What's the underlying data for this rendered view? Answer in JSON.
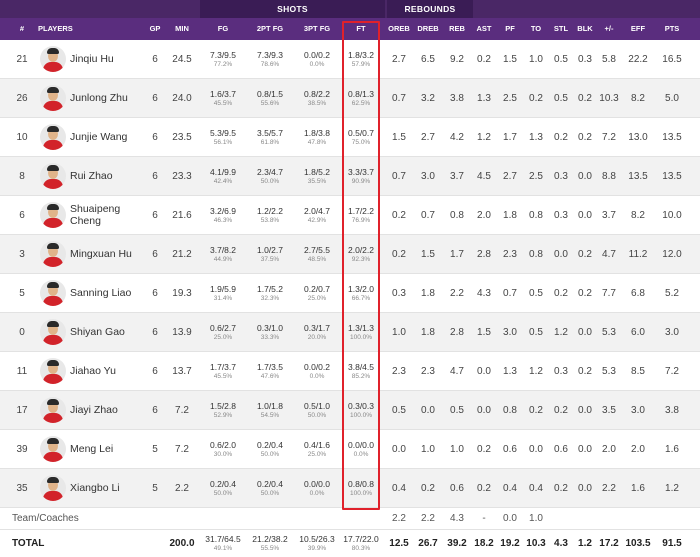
{
  "header": {
    "shots_label": "SHOTS",
    "rebounds_label": "REBOUNDS"
  },
  "columns": [
    "#",
    "PLAYERS",
    "GP",
    "MIN",
    "FG",
    "2PT FG",
    "3PT FG",
    "FT",
    "OREB",
    "DREB",
    "REB",
    "AST",
    "PF",
    "TO",
    "STL",
    "BLK",
    "+/-",
    "EFF",
    "PTS"
  ],
  "players": [
    {
      "num": "21",
      "name": "Jinqiu Hu",
      "gp": "6",
      "min": "24.5",
      "fg": "7.3/9.5",
      "fg_pct": "77.2%",
      "fg2": "7.3/9.3",
      "fg2_pct": "78.6%",
      "fg3": "0.0/0.2",
      "fg3_pct": "0.0%",
      "ft": "1.8/3.2",
      "ft_pct": "57.9%",
      "oreb": "2.7",
      "dreb": "6.5",
      "reb": "9.2",
      "ast": "0.2",
      "pf": "1.5",
      "to": "1.0",
      "stl": "0.5",
      "blk": "0.3",
      "pm": "5.8",
      "eff": "22.2",
      "pts": "16.5"
    },
    {
      "num": "26",
      "name": "Junlong Zhu",
      "gp": "6",
      "min": "24.0",
      "fg": "1.6/3.7",
      "fg_pct": "45.5%",
      "fg2": "0.8/1.5",
      "fg2_pct": "55.6%",
      "fg3": "0.8/2.2",
      "fg3_pct": "38.5%",
      "ft": "0.8/1.3",
      "ft_pct": "62.5%",
      "oreb": "0.7",
      "dreb": "3.2",
      "reb": "3.8",
      "ast": "1.3",
      "pf": "2.5",
      "to": "0.2",
      "stl": "0.5",
      "blk": "0.2",
      "pm": "10.3",
      "eff": "8.2",
      "pts": "5.0"
    },
    {
      "num": "10",
      "name": "Junjie Wang",
      "gp": "6",
      "min": "23.5",
      "fg": "5.3/9.5",
      "fg_pct": "56.1%",
      "fg2": "3.5/5.7",
      "fg2_pct": "61.8%",
      "fg3": "1.8/3.8",
      "fg3_pct": "47.8%",
      "ft": "0.5/0.7",
      "ft_pct": "75.0%",
      "oreb": "1.5",
      "dreb": "2.7",
      "reb": "4.2",
      "ast": "1.2",
      "pf": "1.7",
      "to": "1.3",
      "stl": "0.2",
      "blk": "0.2",
      "pm": "7.2",
      "eff": "13.0",
      "pts": "13.5"
    },
    {
      "num": "8",
      "name": "Rui Zhao",
      "gp": "6",
      "min": "23.3",
      "fg": "4.1/9.9",
      "fg_pct": "42.4%",
      "fg2": "2.3/4.7",
      "fg2_pct": "50.0%",
      "fg3": "1.8/5.2",
      "fg3_pct": "35.5%",
      "ft": "3.3/3.7",
      "ft_pct": "90.9%",
      "oreb": "0.7",
      "dreb": "3.0",
      "reb": "3.7",
      "ast": "4.5",
      "pf": "2.7",
      "to": "2.5",
      "stl": "0.3",
      "blk": "0.0",
      "pm": "8.8",
      "eff": "13.5",
      "pts": "13.5"
    },
    {
      "num": "6",
      "name": "Shuaipeng Cheng",
      "gp": "6",
      "min": "21.6",
      "fg": "3.2/6.9",
      "fg_pct": "46.3%",
      "fg2": "1.2/2.2",
      "fg2_pct": "53.8%",
      "fg3": "2.0/4.7",
      "fg3_pct": "42.9%",
      "ft": "1.7/2.2",
      "ft_pct": "76.9%",
      "oreb": "0.2",
      "dreb": "0.7",
      "reb": "0.8",
      "ast": "2.0",
      "pf": "1.8",
      "to": "0.8",
      "stl": "0.3",
      "blk": "0.0",
      "pm": "3.7",
      "eff": "8.2",
      "pts": "10.0"
    },
    {
      "num": "3",
      "name": "Mingxuan Hu",
      "gp": "6",
      "min": "21.2",
      "fg": "3.7/8.2",
      "fg_pct": "44.9%",
      "fg2": "1.0/2.7",
      "fg2_pct": "37.5%",
      "fg3": "2.7/5.5",
      "fg3_pct": "48.5%",
      "ft": "2.0/2.2",
      "ft_pct": "92.3%",
      "oreb": "0.2",
      "dreb": "1.5",
      "reb": "1.7",
      "ast": "2.8",
      "pf": "2.3",
      "to": "0.8",
      "stl": "0.0",
      "blk": "0.2",
      "pm": "4.7",
      "eff": "11.2",
      "pts": "12.0"
    },
    {
      "num": "5",
      "name": "Sanning Liao",
      "gp": "6",
      "min": "19.3",
      "fg": "1.9/5.9",
      "fg_pct": "31.4%",
      "fg2": "1.7/5.2",
      "fg2_pct": "32.3%",
      "fg3": "0.2/0.7",
      "fg3_pct": "25.0%",
      "ft": "1.3/2.0",
      "ft_pct": "66.7%",
      "oreb": "0.3",
      "dreb": "1.8",
      "reb": "2.2",
      "ast": "4.3",
      "pf": "0.7",
      "to": "0.5",
      "stl": "0.2",
      "blk": "0.2",
      "pm": "7.7",
      "eff": "6.8",
      "pts": "5.2"
    },
    {
      "num": "0",
      "name": "Shiyan Gao",
      "gp": "6",
      "min": "13.9",
      "fg": "0.6/2.7",
      "fg_pct": "25.0%",
      "fg2": "0.3/1.0",
      "fg2_pct": "33.3%",
      "fg3": "0.3/1.7",
      "fg3_pct": "20.0%",
      "ft": "1.3/1.3",
      "ft_pct": "100.0%",
      "oreb": "1.0",
      "dreb": "1.8",
      "reb": "2.8",
      "ast": "1.5",
      "pf": "3.0",
      "to": "0.5",
      "stl": "1.2",
      "blk": "0.0",
      "pm": "5.3",
      "eff": "6.0",
      "pts": "3.0"
    },
    {
      "num": "11",
      "name": "Jiahao Yu",
      "gp": "6",
      "min": "13.7",
      "fg": "1.7/3.7",
      "fg_pct": "45.5%",
      "fg2": "1.7/3.5",
      "fg2_pct": "47.6%",
      "fg3": "0.0/0.2",
      "fg3_pct": "0.0%",
      "ft": "3.8/4.5",
      "ft_pct": "85.2%",
      "oreb": "2.3",
      "dreb": "2.3",
      "reb": "4.7",
      "ast": "0.0",
      "pf": "1.3",
      "to": "1.2",
      "stl": "0.3",
      "blk": "0.2",
      "pm": "5.3",
      "eff": "8.5",
      "pts": "7.2"
    },
    {
      "num": "17",
      "name": "Jiayi Zhao",
      "gp": "6",
      "min": "7.2",
      "fg": "1.5/2.8",
      "fg_pct": "52.9%",
      "fg2": "1.0/1.8",
      "fg2_pct": "54.5%",
      "fg3": "0.5/1.0",
      "fg3_pct": "50.0%",
      "ft": "0.3/0.3",
      "ft_pct": "100.0%",
      "oreb": "0.5",
      "dreb": "0.0",
      "reb": "0.5",
      "ast": "0.0",
      "pf": "0.8",
      "to": "0.2",
      "stl": "0.2",
      "blk": "0.0",
      "pm": "3.5",
      "eff": "3.0",
      "pts": "3.8"
    },
    {
      "num": "39",
      "name": "Meng Lei",
      "gp": "5",
      "min": "7.2",
      "fg": "0.6/2.0",
      "fg_pct": "30.0%",
      "fg2": "0.2/0.4",
      "fg2_pct": "50.0%",
      "fg3": "0.4/1.6",
      "fg3_pct": "25.0%",
      "ft": "0.0/0.0",
      "ft_pct": "0.0%",
      "oreb": "0.0",
      "dreb": "1.0",
      "reb": "1.0",
      "ast": "0.2",
      "pf": "0.6",
      "to": "0.0",
      "stl": "0.6",
      "blk": "0.0",
      "pm": "2.0",
      "eff": "2.0",
      "pts": "1.6"
    },
    {
      "num": "35",
      "name": "Xiangbo Li",
      "gp": "5",
      "min": "2.2",
      "fg": "0.2/0.4",
      "fg_pct": "50.0%",
      "fg2": "0.2/0.4",
      "fg2_pct": "50.0%",
      "fg3": "0.0/0.0",
      "fg3_pct": "0.0%",
      "ft": "0.8/0.8",
      "ft_pct": "100.0%",
      "oreb": "0.4",
      "dreb": "0.2",
      "reb": "0.6",
      "ast": "0.2",
      "pf": "0.4",
      "to": "0.4",
      "stl": "0.2",
      "blk": "0.0",
      "pm": "2.2",
      "eff": "1.6",
      "pts": "1.2"
    }
  ],
  "team": {
    "label": "Team/Coaches",
    "oreb": "2.2",
    "dreb": "2.2",
    "reb": "4.3",
    "ast": "-",
    "pf": "0.0",
    "to": "1.0"
  },
  "total": {
    "label": "TOTAL",
    "min": "200.0",
    "fg": "31.7/64.5",
    "fg_pct": "49.1%",
    "fg2": "21.2/38.2",
    "fg2_pct": "55.5%",
    "fg3": "10.5/26.3",
    "fg3_pct": "39.9%",
    "ft": "17.7/22.0",
    "ft_pct": "80.3%",
    "oreb": "12.5",
    "dreb": "26.7",
    "reb": "39.2",
    "ast": "18.2",
    "pf": "19.2",
    "to": "10.3",
    "stl": "4.3",
    "blk": "1.2",
    "pm": "17.2",
    "eff": "103.5",
    "pts": "91.5"
  },
  "colors": {
    "header_dark": "#3a1c55",
    "header": "#5a2d7e",
    "highlight": "#e0212b",
    "jersey": "#d2232a"
  }
}
